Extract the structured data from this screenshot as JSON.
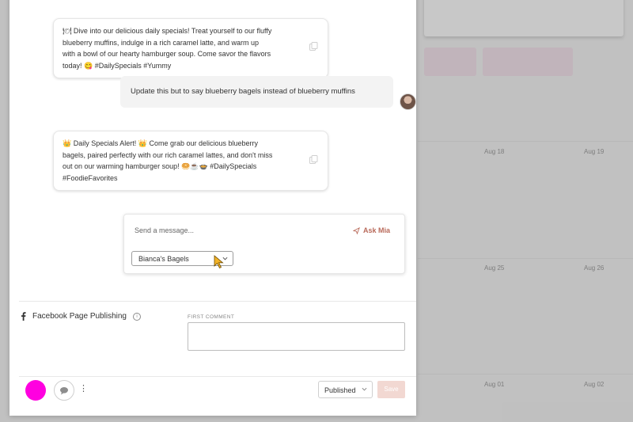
{
  "background_calendar": {
    "dates": [
      "Aug 18",
      "Aug 19",
      "Aug 25",
      "Aug 26",
      "Aug 01",
      "Aug 02"
    ]
  },
  "chat": {
    "messages": [
      {
        "role": "assistant",
        "lines": [
          "🍽 Dive into our delicious daily specials! Treat yourself to our fluffy",
          "blueberry muffins, indulge in a rich caramel latte, and warm up",
          "with a bowl of our hearty hamburger soup. Come savor the flavors",
          "today! 😋 #DailySpecials #Yummy"
        ]
      },
      {
        "role": "user",
        "text": "Update this but to say blueberry bagels instead of blueberry muffins"
      },
      {
        "role": "assistant",
        "lines": [
          "👑 Daily Specials Alert! 👑 Come grab our delicious blueberry",
          "bagels, paired perfectly with our rich caramel lattes, and don't miss",
          "out on our warming hamburger soup! 🥯☕🍲 #DailySpecials",
          "#FoodieFavorites"
        ]
      }
    ],
    "icons": {
      "copy": "copy-icon",
      "send": "paper-plane-icon",
      "dropdown": "chevron-down-icon"
    }
  },
  "composer": {
    "placeholder": "Send a message...",
    "ask_label": "Ask Mia",
    "brand_select": "Bianca's Bagels"
  },
  "facebook": {
    "title": "Facebook Page Publishing",
    "icon": "facebook-f-icon",
    "info_icon": "info-icon",
    "first_comment_label": "FIRST COMMENT",
    "first_comment_value": ""
  },
  "footer": {
    "status": "Published",
    "save_label": "Save",
    "more_label": "⋮",
    "colors": {
      "pink": "#ff00e0",
      "save_bg": "#f2d8d2",
      "ask_accent": "#b96a5a"
    }
  }
}
